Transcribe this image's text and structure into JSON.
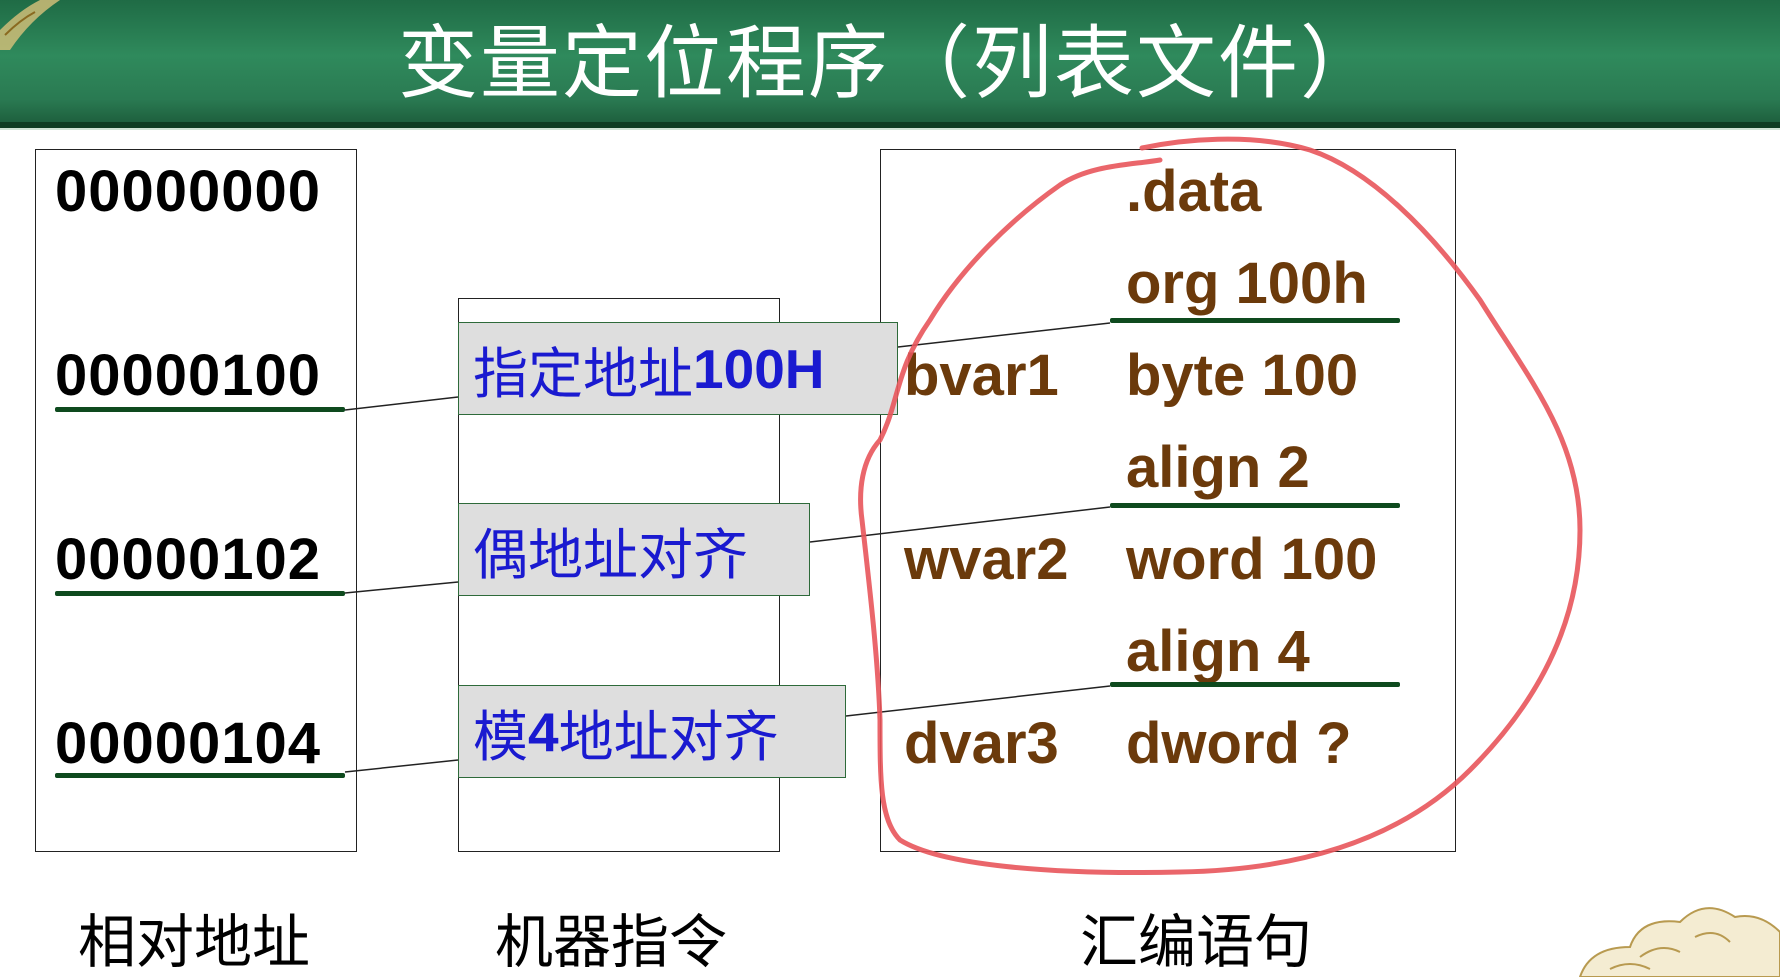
{
  "title": "变量定位程序（列表文件）",
  "addresses": [
    "00000000",
    "00000100",
    "00000102",
    "00000104"
  ],
  "callouts": [
    {
      "text": "指定地址",
      "num": "100H"
    },
    {
      "text": "偶地址对齐",
      "num": ""
    },
    {
      "pre": "模",
      "num": "4",
      "text": "地址对齐"
    }
  ],
  "asm_lines": [
    {
      "label": "",
      "code": ".data"
    },
    {
      "label": "",
      "code": "org 100h"
    },
    {
      "label": "bvar1",
      "code": "byte 100"
    },
    {
      "label": "",
      "code": "align 2"
    },
    {
      "label": "wvar2",
      "code": "word 100"
    },
    {
      "label": "",
      "code": "align 4"
    },
    {
      "label": "dvar3",
      "code": "dword ?"
    }
  ],
  "column_labels": {
    "addr": "相对地址",
    "machine": "机器指令",
    "asm": "汇编语句"
  },
  "colors": {
    "header": "#2a7a52",
    "asm_text": "#6b3a0b",
    "callout_text": "#1a1ad0",
    "annotation": "#e8555b",
    "underline": "#0e4a1e"
  }
}
